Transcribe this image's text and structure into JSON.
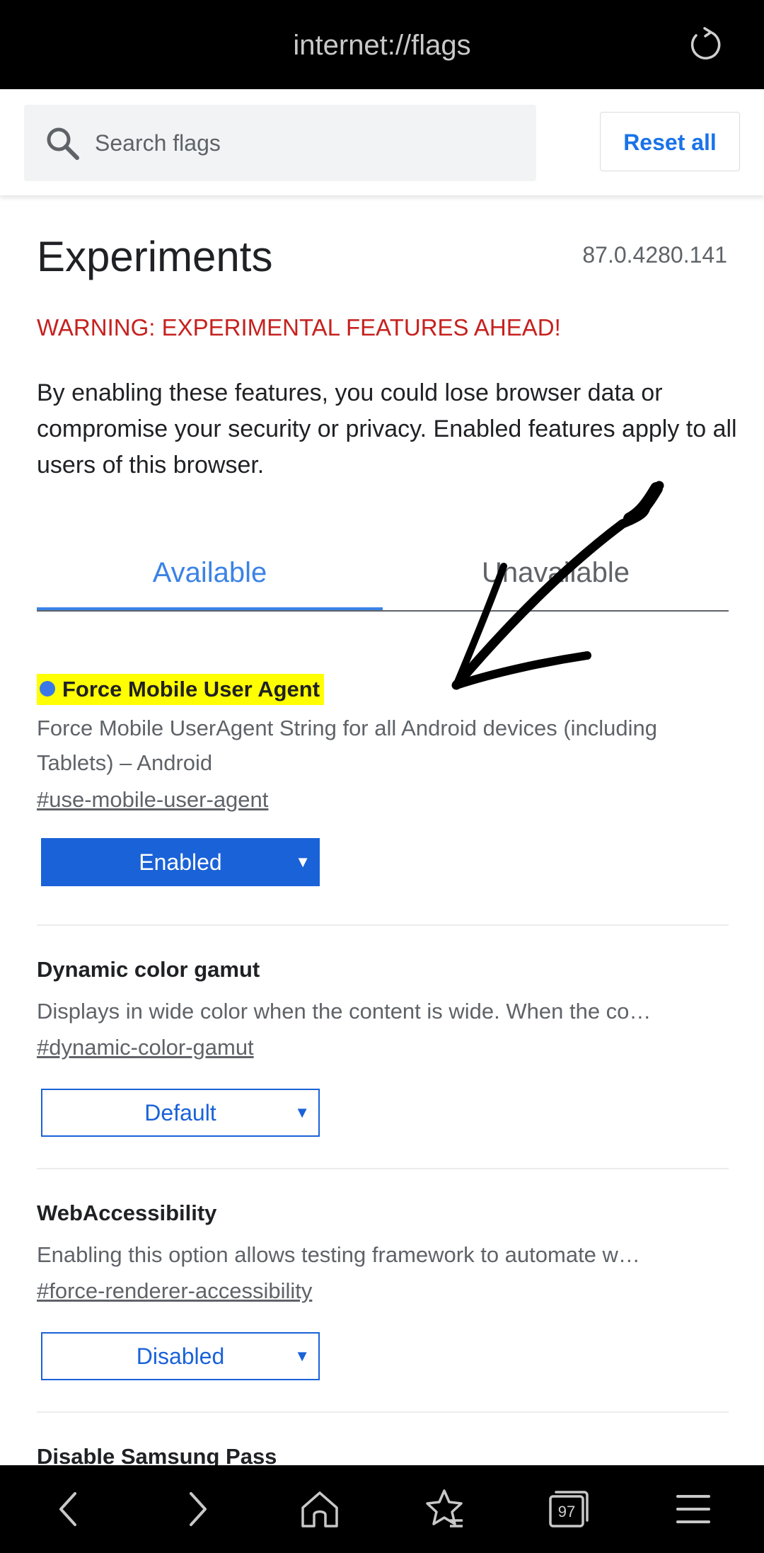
{
  "toolbar": {
    "url": "internet://flags",
    "reload_icon": "reload-icon"
  },
  "search": {
    "placeholder": "Search flags",
    "value": "",
    "reset_label": "Reset all"
  },
  "header": {
    "title": "Experiments",
    "version": "87.0.4280.141",
    "warning": "WARNING: EXPERIMENTAL FEATURES AHEAD!",
    "intro": "By enabling these features, you could lose browser data or compromise your security or privacy. Enabled features apply to all users of this browser."
  },
  "tabs": [
    {
      "label": "Available",
      "selected": true
    },
    {
      "label": "Unavailable",
      "selected": false
    }
  ],
  "experiments": [
    {
      "title": "Force Mobile User Agent",
      "highlighted": true,
      "description": "Force Mobile UserAgent String for all Android devices (including Tablets) – Android",
      "link": "#use-mobile-user-agent",
      "state": "Enabled"
    },
    {
      "title": "Dynamic color gamut",
      "highlighted": false,
      "description": "Displays in wide color when the content is wide. When the co…",
      "link": "#dynamic-color-gamut",
      "state": "Default"
    },
    {
      "title": "WebAccessibility",
      "highlighted": false,
      "description": "Enabling this option allows testing framework to automate w…",
      "link": "#force-renderer-accessibility",
      "state": "Disabled"
    },
    {
      "title": "Disable Samsung Pass",
      "highlighted": false
    }
  ],
  "bottom_nav": {
    "tab_count": "97",
    "icons": [
      "back-icon",
      "forward-icon",
      "home-icon",
      "bookmarks-icon",
      "tabs-icon",
      "menu-icon"
    ]
  },
  "colors": {
    "accent": "#1a73e8",
    "warning": "#c5221f",
    "highlight": "#ffff00",
    "enabled_select": "#1a62d8"
  }
}
